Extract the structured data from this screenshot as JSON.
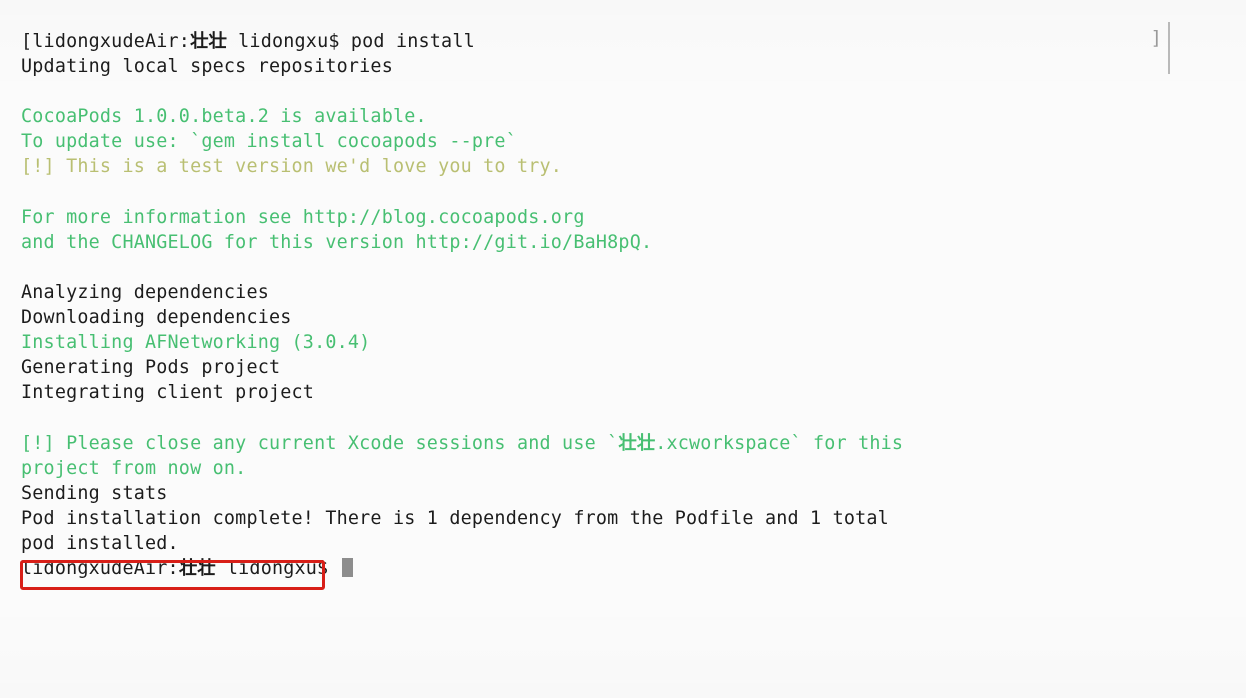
{
  "window": {
    "right_bracket": "]",
    "annotation_color": "#d81f18",
    "background_color": "#fbfbfb",
    "default_text_color": "#1c1c1c",
    "green_text_color": "#47bf72",
    "olive_text_color": "#b9bf72"
  },
  "annotation": {
    "highlighted_text": "Pod installation complete!"
  },
  "terminal": {
    "lines": [
      {
        "id": "prompt-command",
        "color": "default",
        "text": "[lidongxudeAir:壮壮 lidongxu$ pod install"
      },
      {
        "id": "updating-specs",
        "color": "default",
        "text": "Updating local specs repositories"
      },
      {
        "id": "blank-1",
        "color": "default",
        "text": ""
      },
      {
        "id": "cocoapods-available",
        "color": "green",
        "text": "CocoaPods 1.0.0.beta.2 is available."
      },
      {
        "id": "to-update-use",
        "color": "green",
        "text": "To update use: `gem install cocoapods --pre`"
      },
      {
        "id": "test-version-warning",
        "color": "olive",
        "text": "[!] This is a test version we'd love you to try."
      },
      {
        "id": "blank-2",
        "color": "default",
        "text": ""
      },
      {
        "id": "more-information",
        "color": "green",
        "text": "For more information see http://blog.cocoapods.org"
      },
      {
        "id": "changelog",
        "color": "green",
        "text": "and the CHANGELOG for this version http://git.io/BaH8pQ."
      },
      {
        "id": "blank-3",
        "color": "default",
        "text": ""
      },
      {
        "id": "analyzing",
        "color": "default",
        "text": "Analyzing dependencies"
      },
      {
        "id": "downloading",
        "color": "default",
        "text": "Downloading dependencies"
      },
      {
        "id": "installing",
        "color": "green",
        "text": "Installing AFNetworking (3.0.4)"
      },
      {
        "id": "generating",
        "color": "default",
        "text": "Generating Pods project"
      },
      {
        "id": "integrating",
        "color": "default",
        "text": "Integrating client project"
      },
      {
        "id": "blank-4",
        "color": "default",
        "text": ""
      },
      {
        "id": "xcode-warning-1",
        "color": "green",
        "text": "[!] Please close any current Xcode sessions and use `壮壮.xcworkspace` for this"
      },
      {
        "id": "xcode-warning-2",
        "color": "green",
        "text": "project from now on."
      },
      {
        "id": "sending-stats",
        "color": "default",
        "text": "Sending stats"
      },
      {
        "id": "pod-complete",
        "color": "default",
        "text": "Pod installation complete! There is 1 dependency from the Podfile and 1 total"
      },
      {
        "id": "pod-installed",
        "color": "default",
        "text": "pod installed."
      },
      {
        "id": "final-prompt",
        "color": "default",
        "text": "lidongxudeAir:壮壮 lidongxu$ "
      }
    ]
  }
}
